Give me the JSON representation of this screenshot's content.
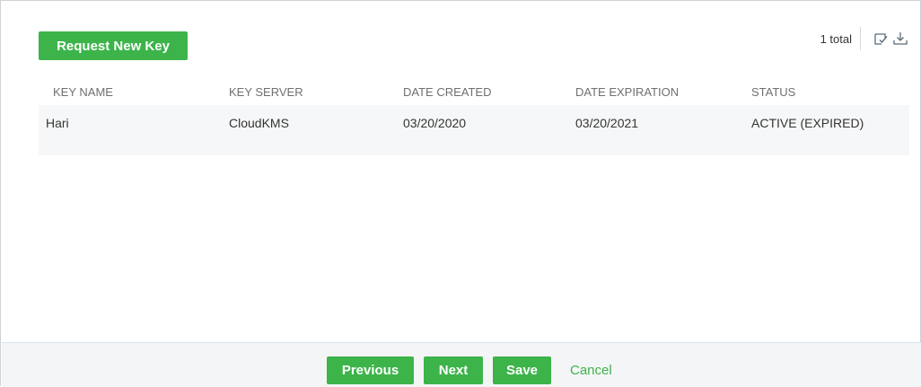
{
  "toolbar": {
    "request_button_label": "Request New Key",
    "total_label": "1 total",
    "icons": [
      "select-checkbox-icon",
      "download-icon"
    ]
  },
  "table": {
    "columns": [
      "KEY NAME",
      "KEY SERVER",
      "DATE CREATED",
      "DATE EXPIRATION",
      "STATUS"
    ],
    "rows": [
      {
        "key_name": "Hari",
        "key_server": "CloudKMS",
        "date_created": "03/20/2020",
        "date_expiration": "03/20/2021",
        "status": "ACTIVE (EXPIRED)"
      }
    ]
  },
  "footer": {
    "previous_label": "Previous",
    "next_label": "Next",
    "save_label": "Save",
    "cancel_label": "Cancel"
  },
  "colors": {
    "accent_green": "#3cb44a",
    "row_background": "#f6f7f8",
    "footer_background": "#f4f5f6"
  }
}
